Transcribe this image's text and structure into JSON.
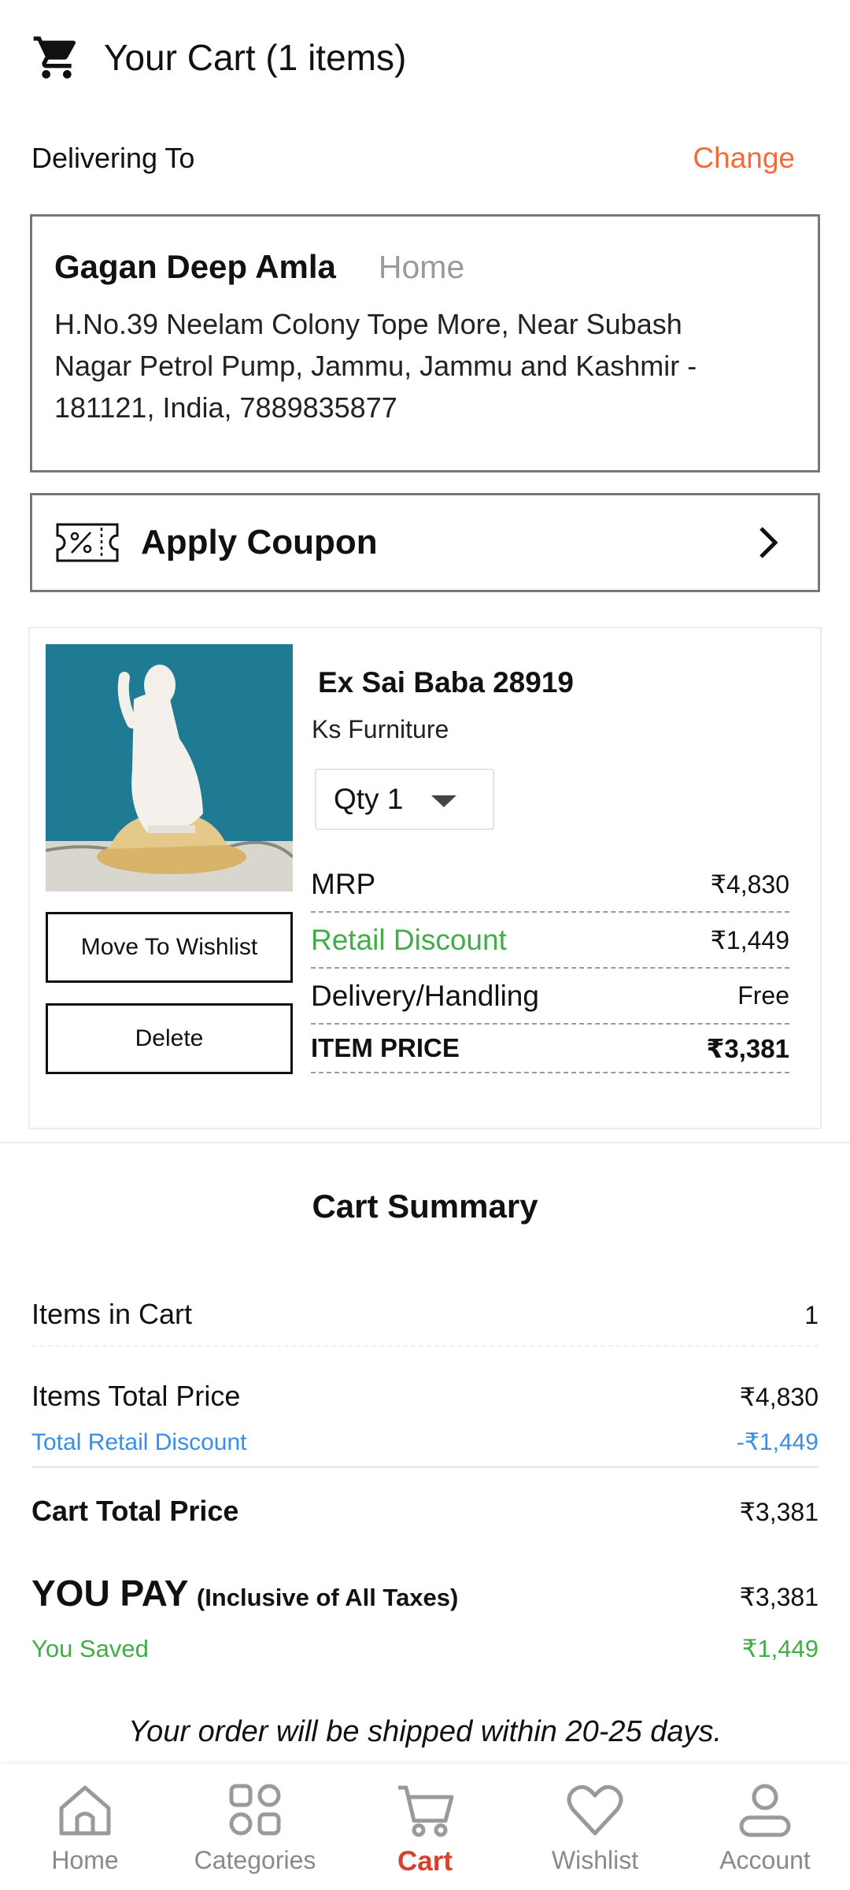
{
  "header": {
    "title": "Your Cart (1 items)",
    "icon": "cart-icon"
  },
  "delivery": {
    "label": "Delivering To",
    "change_label": "Change",
    "name": "Gagan Deep Amla",
    "tag": "Home",
    "address_line1": "H.No.39 Neelam Colony Tope More, Near Subash",
    "address_line2": "Nagar Petrol Pump, Jammu, Jammu and Kashmir -",
    "address_line3": "181121, India, 7889835877"
  },
  "coupon": {
    "label": "Apply Coupon",
    "icon": "coupon-icon"
  },
  "item": {
    "name": "Ex Sai Baba 28919",
    "seller": "Ks Furniture",
    "qty_label": "Qty 1",
    "move_to_wishlist": "Move To Wishlist",
    "delete": "Delete",
    "mrp_label": "MRP",
    "mrp_value": "₹4,830",
    "discount_label": "Retail Discount",
    "discount_value": "₹1,449",
    "delivery_label": "Delivery/Handling",
    "delivery_value": "Free",
    "item_price_label": "ITEM PRICE",
    "item_price_value": "₹3,381"
  },
  "summary": {
    "title": "Cart Summary",
    "items_in_cart_label": "Items in Cart",
    "items_in_cart_value": "1",
    "items_total_label": "Items Total Price",
    "items_total_value": "₹4,830",
    "total_discount_label": "Total Retail Discount",
    "total_discount_value": "-₹1,449",
    "cart_total_label": "Cart Total Price",
    "cart_total_value": "₹3,381",
    "you_pay_label": "YOU PAY",
    "you_pay_note": "(Inclusive of All Taxes)",
    "you_pay_value": "₹3,381",
    "saved_label": "You Saved",
    "saved_value": "₹1,449"
  },
  "shipping_note": "Your order will be shipped within 20-25 days.",
  "nav": {
    "home": "Home",
    "categories": "Categories",
    "cart": "Cart",
    "wishlist": "Wishlist",
    "account": "Account",
    "active": "cart"
  },
  "colors": {
    "accent_orange": "#f26b3a",
    "discount_green": "#3fae49",
    "discount_blue": "#3a8ee6",
    "nav_active_red": "#d9402b"
  }
}
